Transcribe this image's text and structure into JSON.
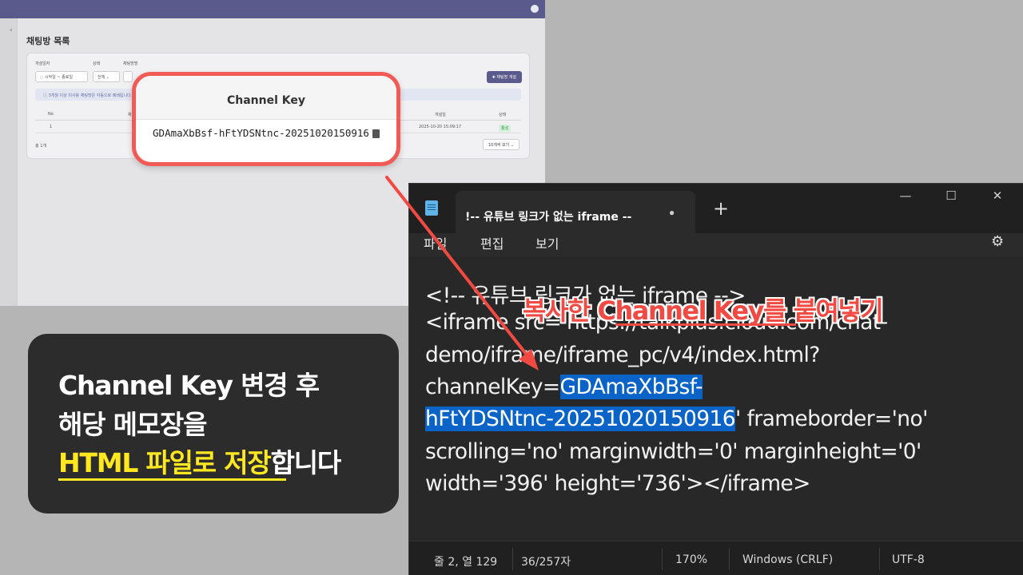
{
  "webapp": {
    "page_title": "채팅방 목록",
    "filters": [
      {
        "label": "개설일자",
        "value": "◌ 시작일 ~ 종료일"
      },
      {
        "label": "상태",
        "value": "전체 ⌄"
      },
      {
        "label": "채팅방명",
        "value": ""
      }
    ],
    "create_button": "✚ 채팅방 개설",
    "info": "ⓘ 3개월 이상 미사용 채팅방은 자동으로 폐쇄됩니다.",
    "table": {
      "headers": [
        "No",
        "채",
        "개설일",
        "상태"
      ],
      "rows": [
        {
          "no": "1",
          "created": "2025-10-20 15:09:17",
          "status": "활성"
        }
      ]
    },
    "total": "총 1개",
    "per_page": "10개씩 보기 ⌄"
  },
  "popup": {
    "title": "Channel Key",
    "key": "GDAmaXbBsf-hFtYDSNtnc-20251020150916"
  },
  "instruction": {
    "line1": "Channel Key 변경 후",
    "line2": "해당 메모장을",
    "line3_highlight": "HTML 파일로 저장",
    "line3_rest": "합니다"
  },
  "notepad": {
    "tab_title": "!-- 유튜브 링크가 없는 iframe --",
    "tab_dot": "●",
    "new_tab": "+",
    "window_controls": {
      "minimize": "—",
      "maximize": "☐",
      "close": "✕"
    },
    "menu": [
      "파일",
      "편집",
      "보기"
    ],
    "settings_icon": "⚙",
    "editor": {
      "line1": "<!-- 유튜브 링크가 없는 iframe -->",
      "line2": "<iframe src='https://talkplus.cloud.com/chat-",
      "line3": "demo/iframe/iframe_pc/v4/index.html?",
      "line4_pre": "channelKey=",
      "line4_sel": "GDAmaXbBsf-",
      "line5_sel": "hFtYDSNtnc-20251020150916",
      "line5_post": "' frameborder='no'",
      "line6": "scrolling='no' marginwidth='0' marginheight='0'",
      "line7": "width='396' height='736'></iframe>"
    },
    "status": {
      "position": "줄 2, 열 129",
      "chars": "36/257자",
      "zoom": "170%",
      "line_ending": "Windows (CRLF)",
      "encoding": "UTF-8"
    }
  },
  "callout": {
    "text": "복사한 Channel Key를 붙여넣기",
    "color": "#f04a43"
  },
  "colors": {
    "accent_red": "#f25b55",
    "highlight_yellow": "#ffe81f",
    "selection_blue": "#0a64c8",
    "topbar": "#5a5a8c"
  }
}
